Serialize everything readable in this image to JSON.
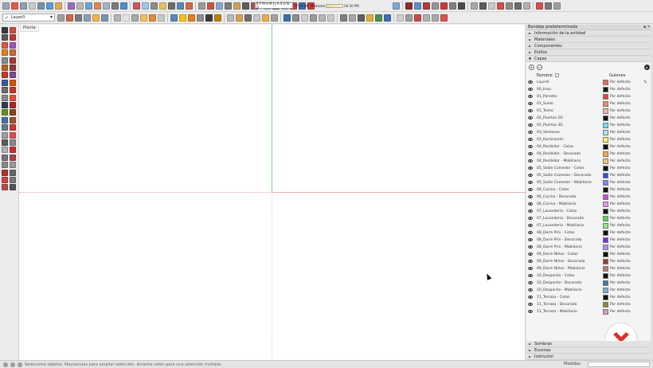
{
  "toolbar": {
    "layer_selected": "Layer0",
    "layer_check": "✓",
    "months": "E F M A M J J A S O N D",
    "time_start": "07:30 AM",
    "time_mid": "Mediodía",
    "time_end": "04:30 PM",
    "row1_colors": [
      "#9aa5b1",
      "#e05b4c",
      "#8fa0b3",
      "#c9c9c9",
      "#7a8fa6",
      "#5a9bd5",
      "#e2a85b",
      "#9a6bbf",
      "#b5b5b5",
      "#6fa3d8",
      "#d88b5b",
      "#9fb4c9",
      "#7b7b7b",
      "#4d8fcf",
      "#c55a5a",
      "#a0c3e8",
      "#8c8c8c",
      "#e3c06a",
      "#6d6d6d",
      "#5b87b5",
      "#cf6b4b",
      "#9b9b9b",
      "#c4574a",
      "#86a7c9",
      "#7c7c7c",
      "#c8a060",
      "#5e5e5e",
      "#a15858",
      "#9bbad6",
      "#6b6b6b",
      "#b3b3b3",
      "#d0463f",
      "#3d6fb5",
      "#cf3d34",
      "#7fa6cc",
      "#8b2a2a",
      "#5f8fc4",
      "#b23a3a",
      "#969696",
      "#c53c3c",
      "#7f7f7f",
      "#4a4a4a",
      "#a8a8a8",
      "#5b5b5b",
      "#c9c9c9",
      "#d14c4c",
      "#8a8a8a",
      "#6c6c6c",
      "#b1b1b1",
      "#d05050",
      "#7a7a7a",
      "#9e9e9e"
    ],
    "row2_colors": [
      "#a0a0a0",
      "#c96a4a",
      "#7a7a7a",
      "#8fa0b3",
      "#f1b24a",
      "#7a93b0",
      "#b5b5b5",
      "#e4e4e4",
      "#a9a9a9",
      "#f0c060",
      "#e18b3f",
      "#c9c9c9",
      "#5b87b5",
      "#f1c40f",
      "#e67e22",
      "#8e8e8e",
      "#3c3c3c",
      "#b8860b",
      "#b9b9b9",
      "#d4a24c",
      "#6e6e6e",
      "#c7c7c7",
      "#e3b04b",
      "#a3a3a3",
      "#3b6ea8",
      "#8d8d8d",
      "#cfcfcf",
      "#9a9a9a",
      "#b5b5b5",
      "#c9c9c9",
      "#7f7f7f",
      "#a7a7a7",
      "#5f5f5f",
      "#e0ac3a",
      "#4e8f4e",
      "#3a6fb0",
      "#cfcfcf",
      "#9f9f9f",
      "#c94a4a",
      "#b0b0b0",
      "#a9a9a9",
      "#d9534f"
    ]
  },
  "palette": {
    "colors": [
      "#3a3a3a",
      "#d24b3f",
      "#5b5b5b",
      "#c0392b",
      "#d65a4a",
      "#9b59b6",
      "#e67e22",
      "#c46a3a",
      "#7f8c8d",
      "#a23b3b",
      "#b5651d",
      "#8e3b3b",
      "#c0392b",
      "#7a4e8f",
      "#3b5998",
      "#d35400",
      "#6d6d6d",
      "#c0392b",
      "#8c8c8c",
      "#e74c3c",
      "#2c3e50",
      "#b22222",
      "#6b8e23",
      "#8b4513",
      "#4a6fa5",
      "#a0522d",
      "#607d8b",
      "#cc3333",
      "#9e9e9e",
      "#d9534f",
      "#5d5d5d",
      "#8a8a8a",
      "#b0b0b0",
      "#c9302c",
      "#777777",
      "#a94442",
      "#888888",
      "#999999",
      "#aa3333",
      "#666666",
      "#cc4444",
      "#7a7a7a",
      "#b84a4a",
      "#555555"
    ]
  },
  "viewport": {
    "scene_tab": "Planta"
  },
  "tray": {
    "title": "Bandeja predeterminada",
    "title_controls": "▪ ✕",
    "sections_top": [
      {
        "label": "Información de la entidad",
        "expanded": false
      },
      {
        "label": "Materiales",
        "expanded": false
      },
      {
        "label": "Componentes",
        "expanded": false
      },
      {
        "label": "Estilos",
        "expanded": false
      },
      {
        "label": "Capas",
        "expanded": true
      }
    ],
    "add_layer": "+",
    "remove_layer": "−",
    "details": "▸",
    "col_name": "Nombre",
    "col_guides": "Guiones",
    "layers": [
      {
        "name": "Layer0",
        "color": "#e56b5d",
        "type": "Por defecto"
      },
      {
        "name": "00_Inau",
        "color": "#1a1a1a",
        "type": "Por defecto"
      },
      {
        "name": "01_Paredes",
        "color": "#d94a3f",
        "type": "Por defecto"
      },
      {
        "name": "01_Suelo",
        "color": "#ee8a6f",
        "type": "Por defecto"
      },
      {
        "name": "01_Techo",
        "color": "#f2b9a2",
        "type": "Por defecto"
      },
      {
        "name": "02_Puertas 2D",
        "color": "#141414",
        "type": "Por defecto"
      },
      {
        "name": "02_Puertas 3D",
        "color": "#6ee3ee",
        "type": "Por defecto"
      },
      {
        "name": "03_Ventanas",
        "color": "#a8e6ef",
        "type": "Por defecto"
      },
      {
        "name": "03_Iluminación",
        "color": "#f6f472",
        "type": "Por defecto"
      },
      {
        "name": "04_Recibidor - Cotas",
        "color": "#111111",
        "type": "Por defecto"
      },
      {
        "name": "04_Recibidor - Decorado",
        "color": "#f4a93d",
        "type": "Por defecto"
      },
      {
        "name": "04_Recibidor - Mobiliario",
        "color": "#f6c77c",
        "type": "Por defecto"
      },
      {
        "name": "05_Salón Comedor - Cotas",
        "color": "#121212",
        "type": "Por defecto"
      },
      {
        "name": "05_Salón Comedor - Decorado",
        "color": "#2f4fd6",
        "type": "Por defecto"
      },
      {
        "name": "05_Salón Comedor - Mobiliario",
        "color": "#7a8cf0",
        "type": "Por defecto"
      },
      {
        "name": "06_Cocina - Cotas",
        "color": "#131313",
        "type": "Por defecto"
      },
      {
        "name": "06_Cocina - Decorado",
        "color": "#d34ae0",
        "type": "Por defecto"
      },
      {
        "name": "06_Cocina - Mobiliario",
        "color": "#ec92f2",
        "type": "Por defecto"
      },
      {
        "name": "07_Lavandería - Cotas",
        "color": "#111111",
        "type": "Por defecto"
      },
      {
        "name": "07_Lavandería - Decorado",
        "color": "#4fd64f",
        "type": "Por defecto"
      },
      {
        "name": "07_Lavandería - Mobiliario",
        "color": "#8fe88f",
        "type": "Por defecto"
      },
      {
        "name": "08_Dorm Prin - Cotas",
        "color": "#101010",
        "type": "Por defecto"
      },
      {
        "name": "08_Dorm Prin - Decorado",
        "color": "#7a2fd6",
        "type": "Por defecto"
      },
      {
        "name": "08_Dorm Prin - Mobiliario",
        "color": "#b58ef0",
        "type": "Por defecto"
      },
      {
        "name": "09_Dorm Niños - Cotas",
        "color": "#121212",
        "type": "Por defecto"
      },
      {
        "name": "09_Dorm Niños - Decorado",
        "color": "#a63a2a",
        "type": "Por defecto"
      },
      {
        "name": "09_Dorm Niños - Mobiliario",
        "color": "#c97a6a",
        "type": "Por defecto"
      },
      {
        "name": "10_Despacho - Cotas",
        "color": "#111111",
        "type": "Por defecto"
      },
      {
        "name": "10_Despacho - Decorado",
        "color": "#3a7a9a",
        "type": "Por defecto"
      },
      {
        "name": "10_Despacho - Mobiliario",
        "color": "#7ab0c9",
        "type": "Por defecto"
      },
      {
        "name": "11_Terraza - Cotas",
        "color": "#101010",
        "type": "Por defecto"
      },
      {
        "name": "11_Terraza - Decorado",
        "color": "#8a8a3a",
        "type": "Por defecto"
      },
      {
        "name": "11_Terraza - Mobiliario",
        "color": "#d4a0c0",
        "type": "Por defecto"
      }
    ],
    "sections_bottom": [
      {
        "label": "Sombras"
      },
      {
        "label": "Escenas"
      },
      {
        "label": "Instructor"
      }
    ]
  },
  "statusbar": {
    "hint": "Seleccione objetos. Mayúsculas para ampliar selección. Arrastre ratón para una selección múltiple.",
    "measure_label": "Medidas"
  },
  "logo": {
    "color": "#d9362b"
  }
}
